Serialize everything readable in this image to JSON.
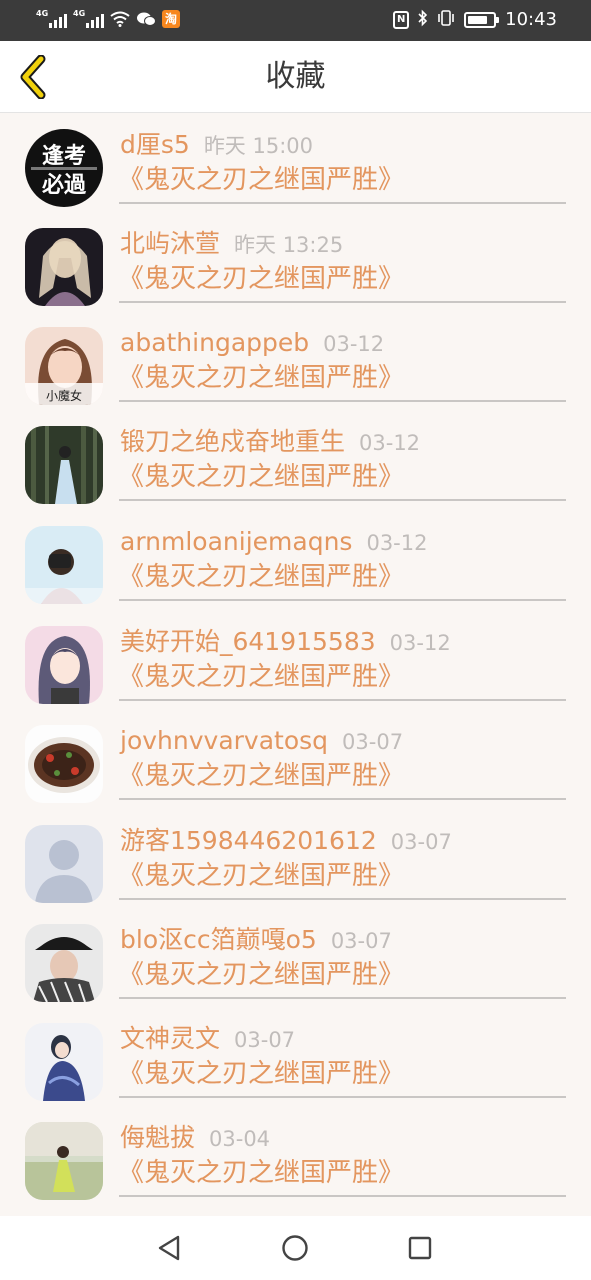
{
  "status_bar": {
    "sim1": "4G",
    "sim2": "4G",
    "shop_icon": "淘",
    "nfc": "N",
    "time": "10:43",
    "battery_level_percent": 80
  },
  "header": {
    "title": "收藏",
    "back_icon": "chevron-left-icon",
    "accent_color": "#f1d10c"
  },
  "list": {
    "text_color": "#e3965f",
    "time_color": "#c0bcba",
    "items": [
      {
        "name": "d厘s5",
        "time": "昨天 15:00",
        "title": "《鬼灭之刃之继国严胜》"
      },
      {
        "name": "北屿沐萱",
        "time": "昨天 13:25",
        "title": "《鬼灭之刃之继国严胜》"
      },
      {
        "name": "abathingappeb",
        "time": "03-12",
        "title": "《鬼灭之刃之继国严胜》",
        "avatar_caption": "小魔女"
      },
      {
        "name": "锻刀之绝戍奋地重生",
        "time": "03-12",
        "title": "《鬼灭之刃之继国严胜》"
      },
      {
        "name": "arnmloanijemaqns",
        "time": "03-12",
        "title": "《鬼灭之刃之继国严胜》"
      },
      {
        "name": "美好开始_641915583",
        "time": "03-12",
        "title": "《鬼灭之刃之继国严胜》"
      },
      {
        "name": "jovhnvvarvatosq",
        "time": "03-07",
        "title": "《鬼灭之刃之继国严胜》"
      },
      {
        "name": "游客1598446201612",
        "time": "03-07",
        "title": "《鬼灭之刃之继国严胜》"
      },
      {
        "name": "blo沤cc箔巅嘎o5",
        "time": "03-07",
        "title": "《鬼灭之刃之继国严胜》"
      },
      {
        "name": "文神灵文",
        "time": "03-07",
        "title": "《鬼灭之刃之继国严胜》"
      },
      {
        "name": "侮魁拔",
        "time": "03-04",
        "title": "《鬼灭之刃之继国严胜》"
      }
    ]
  },
  "avatar_1": {
    "line1": "逢考",
    "line2": "必過"
  },
  "nav_bar": {
    "back": "triangle-back-icon",
    "home": "circle-home-icon",
    "recents": "square-recents-icon"
  }
}
